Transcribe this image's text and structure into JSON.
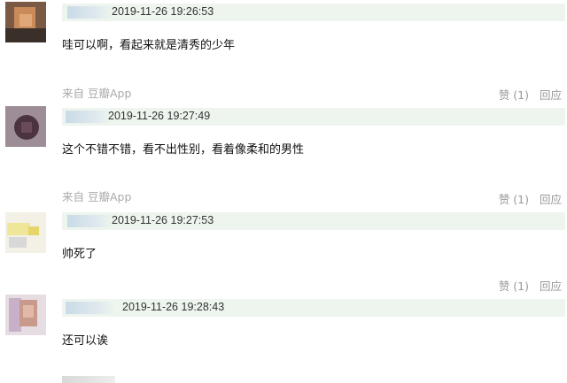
{
  "comments": [
    {
      "time": "2019-11-26 19:26:53",
      "text": "哇可以啊，看起来就是清秀的少年",
      "source": "来自 豆瓣App",
      "like_label": "赞 (1)",
      "reply_label": "回应"
    },
    {
      "time": "2019-11-26 19:27:49",
      "text": "这个不错不错，看不出性别，看着像柔和的男性",
      "source": "来自 豆瓣App",
      "like_label": "赞 (1)",
      "reply_label": "回应"
    },
    {
      "time": "2019-11-26 19:27:53",
      "text": "帅死了",
      "like_label": "赞 (1)",
      "reply_label": "回应"
    },
    {
      "time": "2019-11-26 19:28:43",
      "text": "还可以诶"
    }
  ],
  "colors": {
    "meta_bar_bg": "#eef5ee",
    "source_text": "#aaaaaa",
    "action_text": "#999999"
  }
}
